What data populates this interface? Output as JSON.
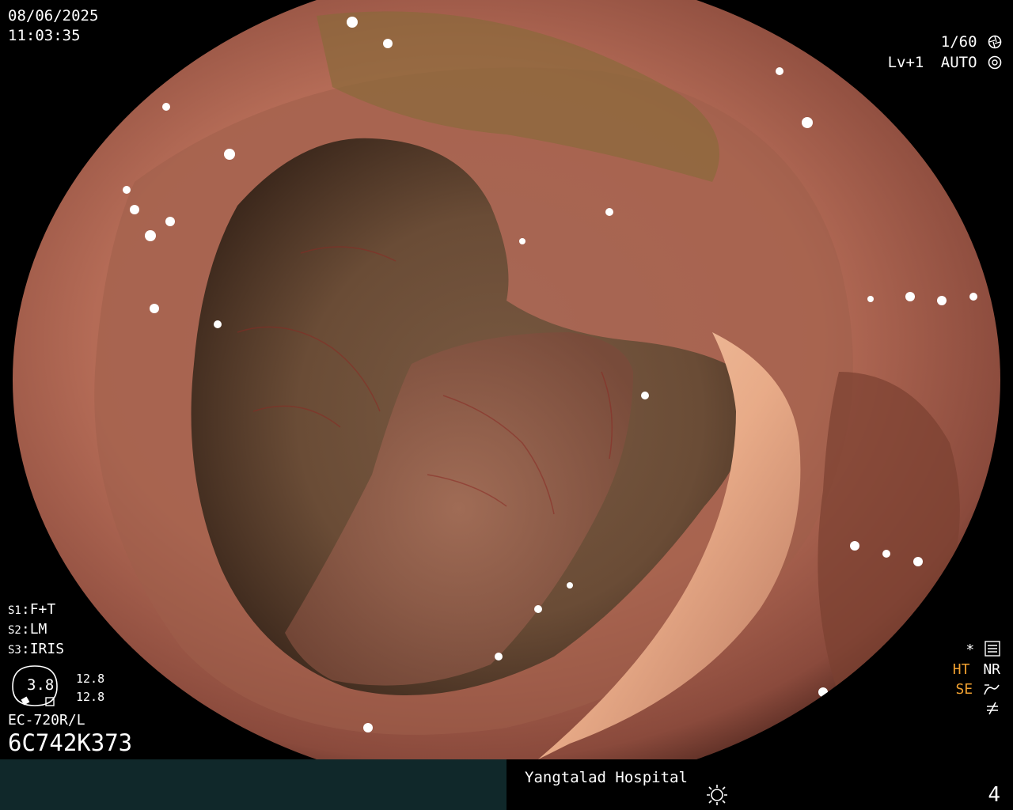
{
  "osd": {
    "date": "08/06/2025",
    "time": "11:03:35",
    "shutter": "1/60",
    "level": "Lv+1",
    "exposure": "AUTO",
    "settings": [
      {
        "key": "S1",
        "value": "F+T"
      },
      {
        "key": "S2",
        "value": "LM"
      },
      {
        "key": "S3",
        "value": "IRIS"
      }
    ],
    "zoom": "3.8",
    "zoom_a": "12.8",
    "zoom_b": "12.8",
    "scope_model": "EC-720R/L",
    "serial": "6C742K373",
    "ind_star": "*",
    "ind_ht": "HT",
    "ind_nr": "NR",
    "ind_se": "SE",
    "hospital": "Yangtalad Hospital",
    "image_number": "4"
  },
  "colors": {
    "footer_left": "#10282a",
    "osd_text": "#ffffff",
    "accent_orange": "#f0a030"
  },
  "icons": [
    "aperture-icon",
    "auto-iris-icon",
    "menu-icon",
    "curve-icon",
    "not-equal-icon",
    "sun-icon"
  ]
}
